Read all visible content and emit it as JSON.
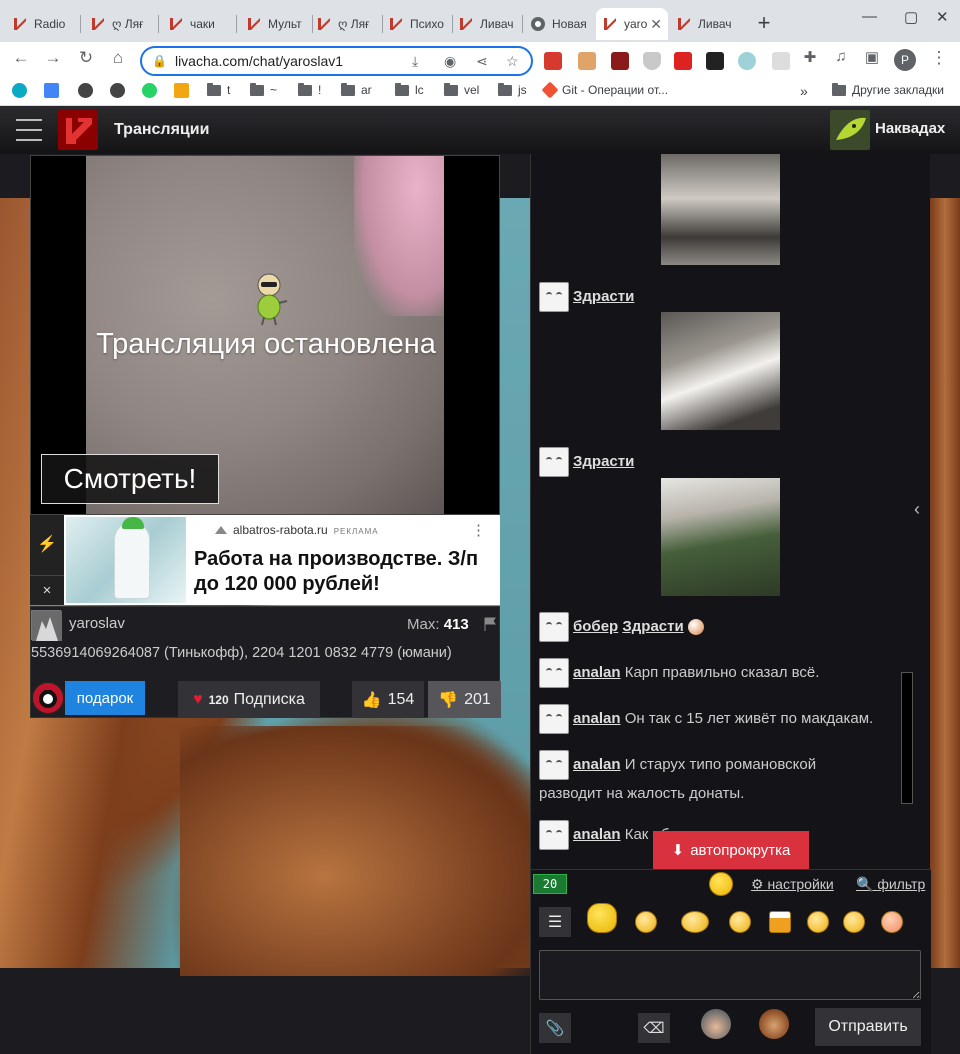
{
  "browser": {
    "tabs": [
      {
        "label": "Radio"
      },
      {
        "label": "ღ Ляғ"
      },
      {
        "label": "чаки"
      },
      {
        "label": "Мульт"
      },
      {
        "label": "ღ Ляғ"
      },
      {
        "label": "Психо"
      },
      {
        "label": "Ливач"
      },
      {
        "label": "Новая"
      },
      {
        "label": "yaro"
      },
      {
        "label": "Ливач"
      }
    ],
    "new_tab": "+",
    "window_controls": [
      "—",
      "▢",
      "✕"
    ],
    "url": "livacha.com/chat/yaroslav1",
    "profile_initial": "P",
    "bookmarks": [
      {
        "label": "t"
      },
      {
        "label": "~"
      },
      {
        "label": "!"
      },
      {
        "label": "ar"
      },
      {
        "label": "lc"
      },
      {
        "label": "vel"
      },
      {
        "label": "js"
      },
      {
        "label": "Git - Операции от..."
      }
    ],
    "bookmarks_more": "»",
    "other_bookmarks": "Другие закладки"
  },
  "site": {
    "title": "Трансляции",
    "user_name": "Наквадах"
  },
  "player": {
    "status_text": "Трансляция остановлена",
    "watch_label": "Смотреть!"
  },
  "ad": {
    "domain": "albatros-rabota.ru",
    "label": "РЕКЛАМА",
    "headline": "Работа на производстве. З/п до 120 000 рублей!",
    "close": "×"
  },
  "streamer": {
    "name": "yaroslav",
    "max_label": "Max:",
    "max_value": "413",
    "description": "5536914069264087 (Тинькофф), 2204 1201 0832 4779 (юмани)",
    "gift_label": "подарок",
    "subscribe_count": "120",
    "subscribe_label": "Подписка",
    "likes": "154",
    "dislikes": "201"
  },
  "chat": {
    "messages": [
      {
        "nick": "Здрасти",
        "text": ""
      },
      {
        "nick": "Здрасти",
        "text": ""
      },
      {
        "nick": "бобер",
        "nick2": "Здрасти",
        "text": ""
      },
      {
        "nick": "analan",
        "text": "Карп правильно сказал всё."
      },
      {
        "nick": "analan",
        "text": "Он так с 15 лет живёт по макдакам."
      },
      {
        "nick": "analan",
        "text": "И старух типо романовской",
        "text2": "разводит на жалость донаты."
      },
      {
        "nick": "analan",
        "text": "Как обычно"
      }
    ],
    "autoscroll_label": "автопрокрутка",
    "online_count": "20",
    "settings_label": "настройки",
    "filter_label": "фильтр",
    "send_label": "Отправить"
  }
}
